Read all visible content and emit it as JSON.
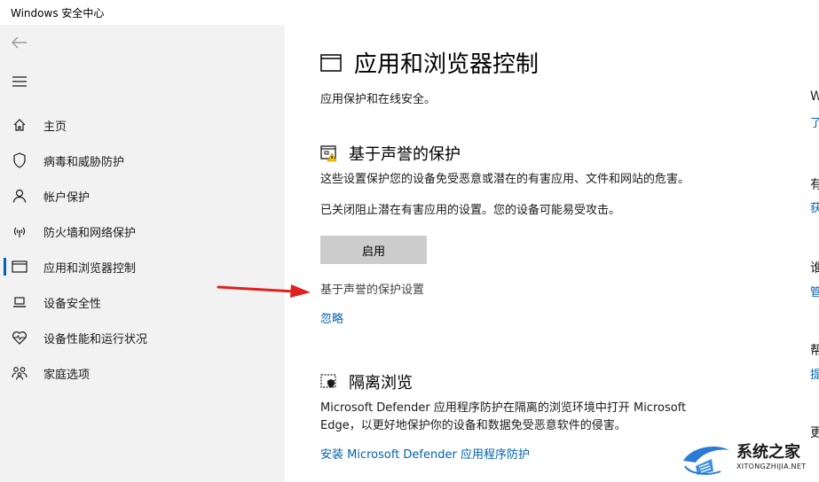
{
  "window": {
    "title": "Windows 安全中心"
  },
  "sidebar": {
    "items": [
      {
        "label": "主页",
        "icon": "home-icon"
      },
      {
        "label": "病毒和威胁防护",
        "icon": "shield-icon"
      },
      {
        "label": "帐户保护",
        "icon": "person-icon"
      },
      {
        "label": "防火墙和网络保护",
        "icon": "wifi-icon"
      },
      {
        "label": "应用和浏览器控制",
        "icon": "app-window-icon",
        "active": true
      },
      {
        "label": "设备安全性",
        "icon": "laptop-icon"
      },
      {
        "label": "设备性能和运行状况",
        "icon": "heart-icon"
      },
      {
        "label": "家庭选项",
        "icon": "family-icon"
      }
    ]
  },
  "main": {
    "title": "应用和浏览器控制",
    "subtitle": "应用保护和在线安全。",
    "reputation": {
      "title": "基于声誉的保护",
      "description": "这些设置保护您的设备免受恶意或潜在的有害应用、文件和网站的危害。",
      "warning": "已关闭阻止潜在有害应用的设置。您的设备可能易受攻击。",
      "enable_button": "启用",
      "settings_link": "基于声誉的保护设置",
      "ignore_link": "忽略"
    },
    "isolated": {
      "title": "隔离浏览",
      "description_line1": "Microsoft Defender 应用程序防护在隔离的浏览环境中打开 Microsoft",
      "description_line2": "Edge，以更好地保护你的设备和数据免受恶意软件的侵害。",
      "install_link": "安装 Microsoft Defender 应用程序防护"
    }
  },
  "right_column": {
    "items": [
      "W",
      "了",
      "有",
      "获",
      "谁",
      "管",
      "帮",
      "提",
      "更"
    ]
  },
  "watermark": {
    "title": "系统之家",
    "subtitle": "XITONGZHIJIA.NET"
  },
  "colors": {
    "accent": "#0063b1",
    "sidebar_bg": "#f2f2f2",
    "button_bg": "#cccccc",
    "arrow": "#e02020"
  }
}
